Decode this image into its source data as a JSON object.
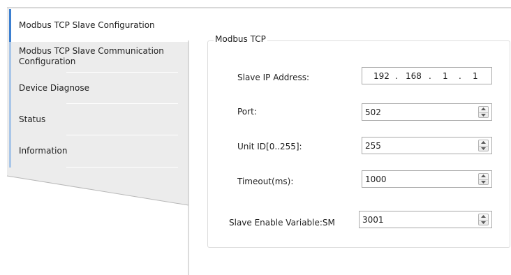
{
  "nav": {
    "items": [
      {
        "label": "Modbus TCP Slave Configuration",
        "active": true
      },
      {
        "label": "Modbus TCP Slave Communication Configuration",
        "active": false
      },
      {
        "label": "Device Diagnose",
        "active": false
      },
      {
        "label": "Status",
        "active": false
      },
      {
        "label": "Information",
        "active": false
      }
    ]
  },
  "group": {
    "title": "Modbus TCP",
    "ip": {
      "label": "Slave IP Address:",
      "octets": [
        "192",
        "168",
        "1",
        "1"
      ],
      "separator": "."
    },
    "port": {
      "label": "Port:",
      "value": "502"
    },
    "unit_id": {
      "label": "Unit ID[0..255]:",
      "value": "255"
    },
    "timeout": {
      "label": "Timeout(ms):",
      "value": "1000"
    },
    "enable_var": {
      "label": "Slave Enable Variable:SM",
      "value": "3001"
    }
  },
  "colors": {
    "accent_active": "#3c7fd0",
    "accent_inactive": "#a9c6e8",
    "nav_bg": "#ececec"
  },
  "icons": {
    "spin": "spin-up-down-icon"
  }
}
